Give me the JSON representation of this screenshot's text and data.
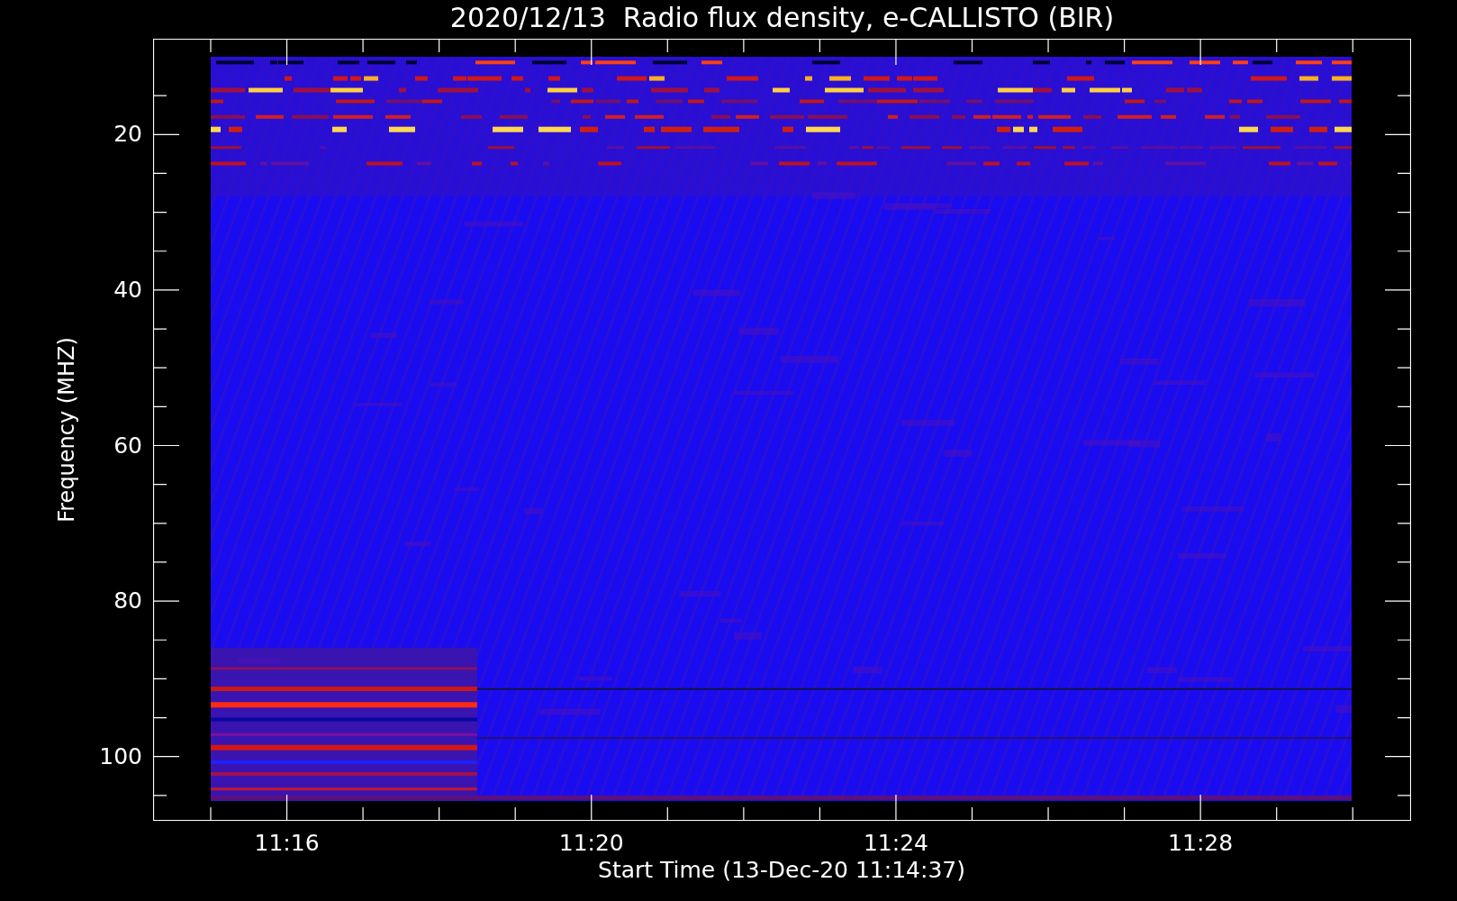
{
  "title": "2020/12/13  Radio flux density, e-CALLISTO (BIR)",
  "y_axis": {
    "label": "Frequency (MHZ)",
    "ticks": [
      "20",
      "40",
      "60",
      "80",
      "100"
    ]
  },
  "x_axis": {
    "label": "Start Time (13-Dec-20 11:14:37)",
    "ticks": [
      "11:16",
      "11:20",
      "11:24",
      "11:28"
    ]
  }
}
